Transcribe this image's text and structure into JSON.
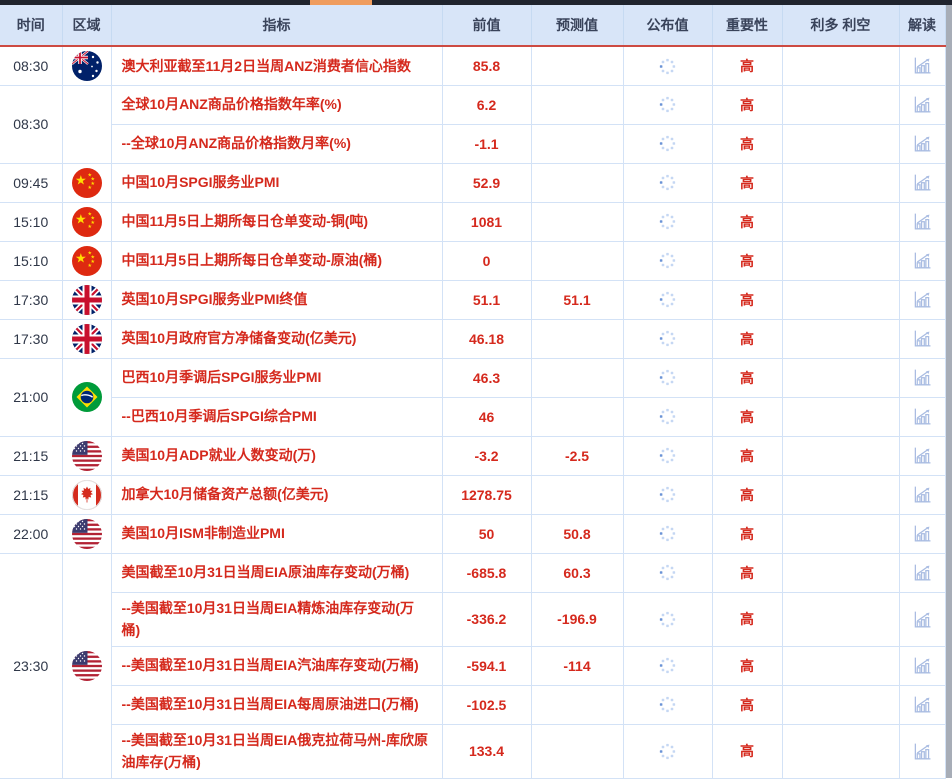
{
  "top_scrollbar": {
    "track_color": "#20242e",
    "thumb_color": "#ef9c5e"
  },
  "header": {
    "columns": [
      "时间",
      "区域",
      "指标",
      "前值",
      "预测值",
      "公布值",
      "重要性",
      "利多 利空",
      "解读"
    ]
  },
  "colors": {
    "value_red": "#d5291d",
    "header_bg": "#d8e5f8",
    "header_text": "#39435a",
    "header_underline": "#cd4a42",
    "grid_border": "#d3e2f6",
    "spinner_blue": "#c5d7f3",
    "interpret_icon_blue": "#a9bce2"
  },
  "icons": {
    "published_pending": "loading-spinner",
    "interpretation": "bar-chart-up-arrow"
  },
  "rows": [
    {
      "time": "08:30",
      "region": "australia",
      "indicator": "澳大利亚截至11月2日当周ANZ消费者信心指数",
      "previous": "85.8",
      "forecast": "",
      "importance": "高"
    },
    {
      "time": "08:30",
      "region": "",
      "indicator": "全球10月ANZ商品价格指数年率(%)",
      "previous": "6.2",
      "forecast": "",
      "importance": "高"
    },
    {
      "indicator": "--全球10月ANZ商品价格指数月率(%)",
      "previous": "-1.1",
      "forecast": "",
      "importance": "高"
    },
    {
      "time": "09:45",
      "region": "china",
      "indicator": "中国10月SPGI服务业PMI",
      "previous": "52.9",
      "forecast": "",
      "importance": "高"
    },
    {
      "time": "15:10",
      "region": "china",
      "indicator": "中国11月5日上期所每日仓单变动-铜(吨)",
      "previous": "1081",
      "forecast": "",
      "importance": "高"
    },
    {
      "time": "15:10",
      "region": "china",
      "indicator": "中国11月5日上期所每日仓单变动-原油(桶)",
      "previous": "0",
      "forecast": "",
      "importance": "高"
    },
    {
      "time": "17:30",
      "region": "uk",
      "indicator": "英国10月SPGI服务业PMI终值",
      "previous": "51.1",
      "forecast": "51.1",
      "importance": "高"
    },
    {
      "time": "17:30",
      "region": "uk",
      "indicator": "英国10月政府官方净储备变动(亿美元)",
      "previous": "46.18",
      "forecast": "",
      "importance": "高"
    },
    {
      "time": "21:00",
      "region": "brazil",
      "indicator": "巴西10月季调后SPGI服务业PMI",
      "previous": "46.3",
      "forecast": "",
      "importance": "高"
    },
    {
      "indicator": "--巴西10月季调后SPGI综合PMI",
      "previous": "46",
      "forecast": "",
      "importance": "高"
    },
    {
      "time": "21:15",
      "region": "usa",
      "indicator": "美国10月ADP就业人数变动(万)",
      "previous": "-3.2",
      "forecast": "-2.5",
      "importance": "高"
    },
    {
      "time": "21:15",
      "region": "canada",
      "indicator": "加拿大10月储备资产总额(亿美元)",
      "previous": "1278.75",
      "forecast": "",
      "importance": "高"
    },
    {
      "time": "22:00",
      "region": "usa",
      "indicator": "美国10月ISM非制造业PMI",
      "previous": "50",
      "forecast": "50.8",
      "importance": "高"
    },
    {
      "time": "23:30",
      "region": "usa",
      "indicator": "美国截至10月31日当周EIA原油库存变动(万桶)",
      "previous": "-685.8",
      "forecast": "60.3",
      "importance": "高"
    },
    {
      "indicator": "--美国截至10月31日当周EIA精炼油库存变动(万桶)",
      "previous": "-336.2",
      "forecast": "-196.9",
      "importance": "高"
    },
    {
      "indicator": "--美国截至10月31日当周EIA汽油库存变动(万桶)",
      "previous": "-594.1",
      "forecast": "-114",
      "importance": "高"
    },
    {
      "indicator": "--美国截至10月31日当周EIA每周原油进口(万桶)",
      "previous": "-102.5",
      "forecast": "",
      "importance": "高"
    },
    {
      "indicator": "--美国截至10月31日当周EIA俄克拉荷马州-库欣原油库存(万桶)",
      "previous": "133.4",
      "forecast": "",
      "importance": "高"
    }
  ]
}
